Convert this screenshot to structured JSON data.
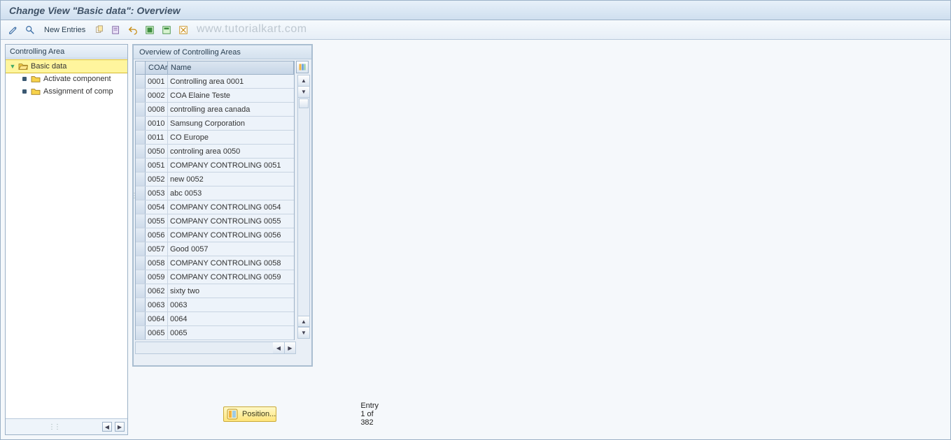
{
  "title": "Change View \"Basic data\": Overview",
  "toolbar": {
    "new_entries": "New Entries"
  },
  "watermark": "www.tutorialkart.com",
  "sidebar": {
    "header": "Controlling Area",
    "root": "Basic data",
    "children": [
      "Activate component",
      "Assignment of comp"
    ]
  },
  "table": {
    "title": "Overview of Controlling Areas",
    "col_coar": "COAr",
    "col_name": "Name",
    "rows": [
      {
        "coar": "0001",
        "name": "Controlling area 0001"
      },
      {
        "coar": "0002",
        "name": "COA Elaine Teste"
      },
      {
        "coar": "0008",
        "name": "controlling area canada"
      },
      {
        "coar": "0010",
        "name": "Samsung Corporation"
      },
      {
        "coar": "0011",
        "name": "CO Europe"
      },
      {
        "coar": "0050",
        "name": "controling area 0050"
      },
      {
        "coar": "0051",
        "name": "COMPANY CONTROLING 0051"
      },
      {
        "coar": "0052",
        "name": "new 0052"
      },
      {
        "coar": "0053",
        "name": "abc 0053"
      },
      {
        "coar": "0054",
        "name": "COMPANY CONTROLING 0054"
      },
      {
        "coar": "0055",
        "name": "COMPANY CONTROLING 0055"
      },
      {
        "coar": "0056",
        "name": "COMPANY CONTROLING 0056"
      },
      {
        "coar": "0057",
        "name": "Good 0057"
      },
      {
        "coar": "0058",
        "name": "COMPANY CONTROLING 0058"
      },
      {
        "coar": "0059",
        "name": "COMPANY CONTROLING 0059"
      },
      {
        "coar": "0062",
        "name": "sixty two"
      },
      {
        "coar": "0063",
        "name": "0063"
      },
      {
        "coar": "0064",
        "name": "0064"
      },
      {
        "coar": "0065",
        "name": "0065"
      }
    ]
  },
  "footer": {
    "position_label": "Position...",
    "entry_text": "Entry 1 of 382"
  }
}
